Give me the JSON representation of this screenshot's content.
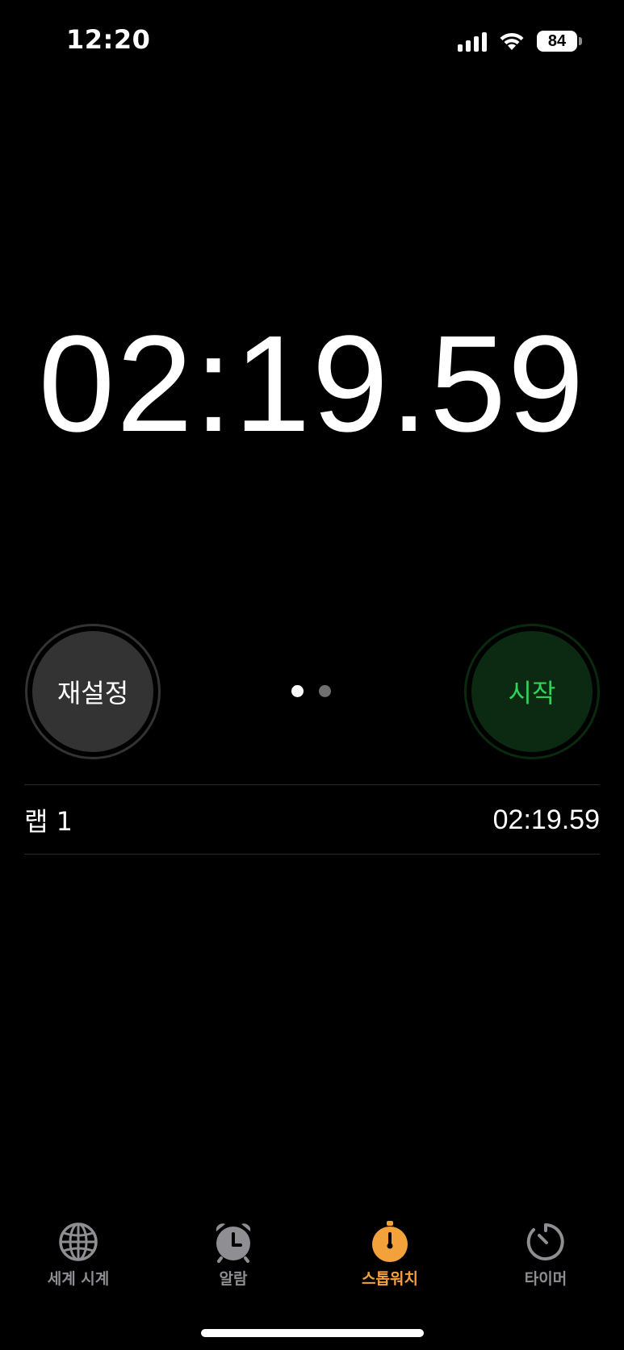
{
  "status_bar": {
    "time": "12:20",
    "battery": "84",
    "icons": [
      "signal-icon",
      "wifi-icon",
      "battery-icon"
    ]
  },
  "stopwatch": {
    "display": "02:19.59"
  },
  "buttons": {
    "reset_label": "재설정",
    "start_label": "시작"
  },
  "pager": {
    "pages": 2,
    "current": 1
  },
  "laps": [
    {
      "label": "랩 1",
      "time": "02:19.59"
    }
  ],
  "tabs": [
    {
      "label": "세계 시계",
      "icon": "globe-icon",
      "active": false
    },
    {
      "label": "알람",
      "icon": "alarm-clock-icon",
      "active": false
    },
    {
      "label": "스톱워치",
      "icon": "stopwatch-icon",
      "active": true
    },
    {
      "label": "타이머",
      "icon": "timer-icon",
      "active": false
    }
  ],
  "colors": {
    "background": "#000000",
    "start_text": "#32d158",
    "start_bg": "#0c2a12",
    "reset_bg": "#333333",
    "tab_active": "#f3a23b",
    "tab_inactive": "#8e8e93"
  }
}
